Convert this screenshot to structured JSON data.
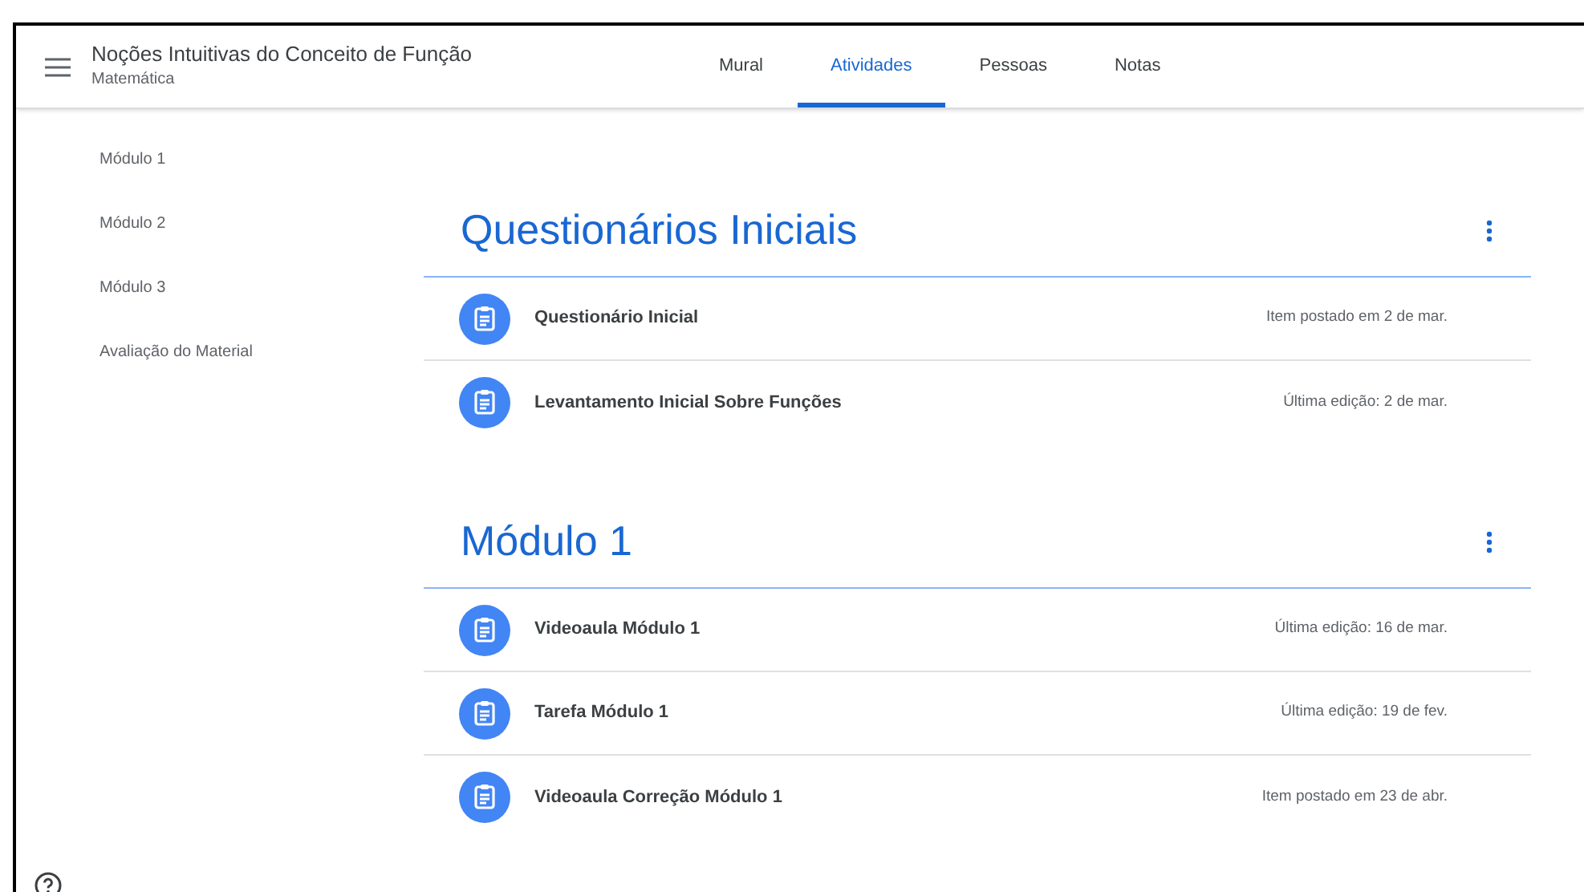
{
  "header": {
    "title": "Noções Intuitivas do Conceito de Função",
    "subtitle": "Matemática"
  },
  "tabs": [
    {
      "label": "Mural",
      "selected": false
    },
    {
      "label": "Atividades",
      "selected": true
    },
    {
      "label": "Pessoas",
      "selected": false
    },
    {
      "label": "Notas",
      "selected": false
    }
  ],
  "sidebar": {
    "items": [
      "Módulo 1",
      "Módulo 2",
      "Módulo 3",
      "Avaliação do Material"
    ]
  },
  "topics": [
    {
      "title": "Questionários Iniciais",
      "items": [
        {
          "title": "Questionário Inicial",
          "meta": "Item postado em 2 de mar."
        },
        {
          "title": "Levantamento Inicial Sobre Funções",
          "meta": "Última edição: 2 de mar."
        }
      ]
    },
    {
      "title": "Módulo 1",
      "items": [
        {
          "title": "Videoaula Módulo 1",
          "meta": "Última edição: 16 de mar."
        },
        {
          "title": "Tarefa Módulo 1",
          "meta": "Última edição: 19 de fev."
        },
        {
          "title": "Videoaula Correção Módulo 1",
          "meta": "Item postado em 23 de abr."
        }
      ]
    }
  ]
}
